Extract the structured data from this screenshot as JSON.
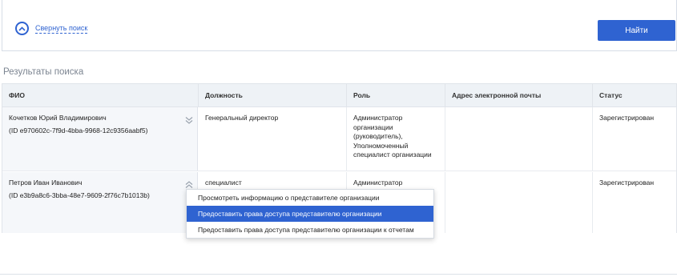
{
  "search": {
    "collapse_label": "Свернуть поиск",
    "find_label": "Найти"
  },
  "results": {
    "title": "Результаты поиска",
    "columns": [
      "ФИО",
      "Должность",
      "Роль",
      "Адрес электронной почты",
      "Статус"
    ],
    "rows": [
      {
        "name": "Кочетков Юрий Владимирович",
        "id": "(ID e970602c-7f9d-4bba-9968-12c9356aabf5)",
        "position": "Генеральный директор",
        "role": "Администратор организации (руководитель), Уполномоченный специалист организации",
        "email": "",
        "status": "Зарегистрирован",
        "expanded": false
      },
      {
        "name": "Петров Иван Иванович",
        "id": "(ID e3b9a8c6-3bba-48e7-9609-2f76c7b1013b)",
        "position": "специалист",
        "role": "Администратор",
        "email": "",
        "status": "Зарегистрирован",
        "expanded": true
      }
    ]
  },
  "context_menu": {
    "items": [
      "Просмотреть информацию о представителе организации",
      "Предоставить права доступа представителю организации",
      "Предоставить права доступа представителю организации к отчетам"
    ],
    "highlighted_index": 1
  },
  "icons": {
    "collapse": "chevron-up-circle-icon",
    "row_expand": "double-chevron-down-icon",
    "row_collapse": "double-chevron-up-icon"
  },
  "colors": {
    "accent": "#2f63d1",
    "header_bg": "#eef2f6",
    "fio_bg": "#f5f7fa"
  }
}
